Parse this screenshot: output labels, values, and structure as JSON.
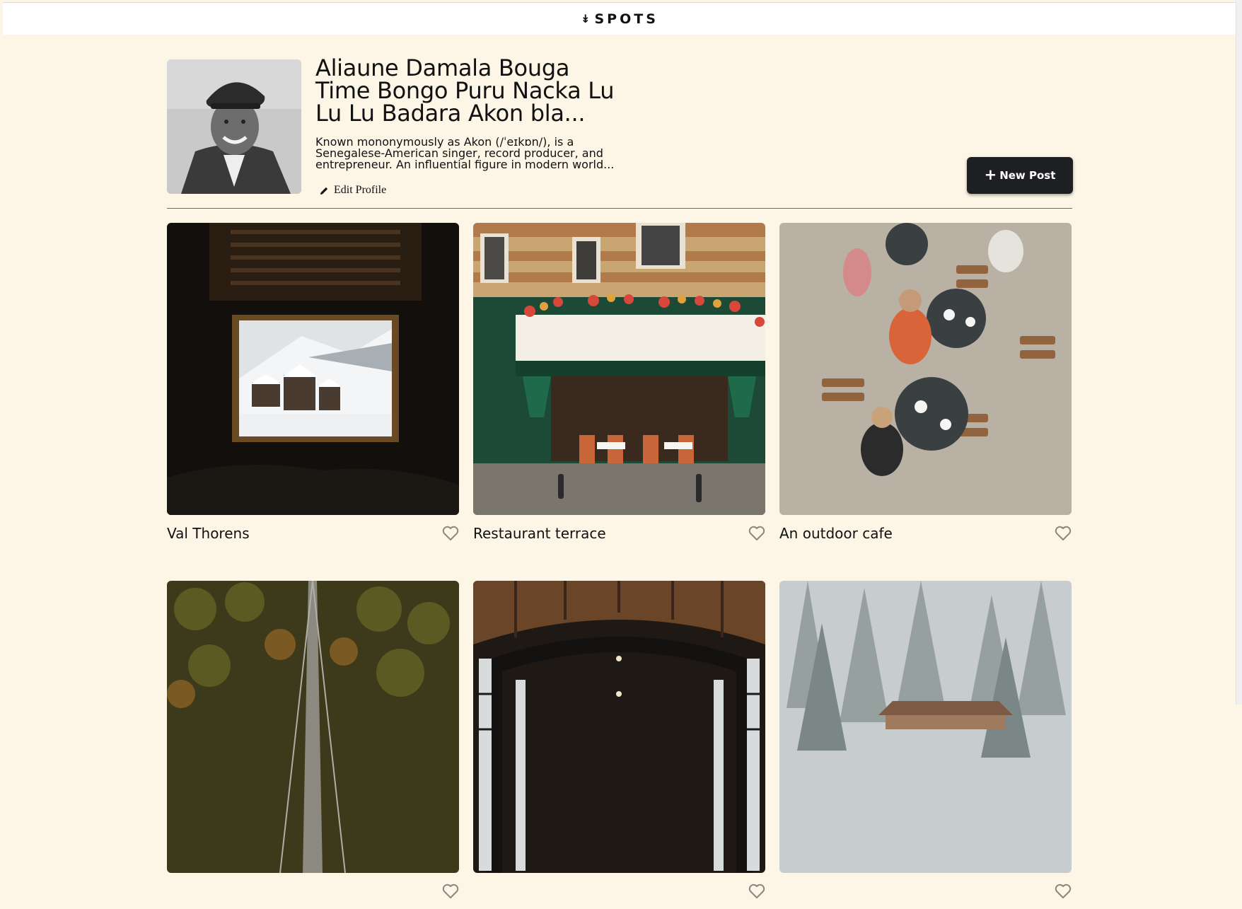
{
  "header": {
    "logo_icon": "arrow-down-icon",
    "logo_text": "SPOTS"
  },
  "profile": {
    "name": "Aliaune Damala Bouga Time Bongo Puru Nacka Lu Lu Lu Badara Akon bla...",
    "description": "Known mononymously as Akon (/ˈeɪkɒn/), is a Senegalese-American singer, record producer, and entrepreneur. An influential figure in modern world...",
    "edit_label": "Edit Profile",
    "edit_icon": "pencil-icon"
  },
  "actions": {
    "new_post_label": "New Post",
    "new_post_icon": "plus-icon"
  },
  "cards": [
    {
      "title": "Val Thorens",
      "like_icon": "heart-outline-icon"
    },
    {
      "title": "Restaurant terrace",
      "like_icon": "heart-outline-icon"
    },
    {
      "title": "An outdoor cafe",
      "like_icon": "heart-outline-icon"
    },
    {
      "title": "",
      "like_icon": "heart-outline-icon"
    },
    {
      "title": "",
      "like_icon": "heart-outline-icon"
    },
    {
      "title": "",
      "like_icon": "heart-outline-icon"
    }
  ],
  "colors": {
    "page_background": "#fdf5e6",
    "header_background": "#ffffff",
    "button_background": "#1d1f22",
    "button_text": "#ffffff",
    "text": "#111111"
  }
}
